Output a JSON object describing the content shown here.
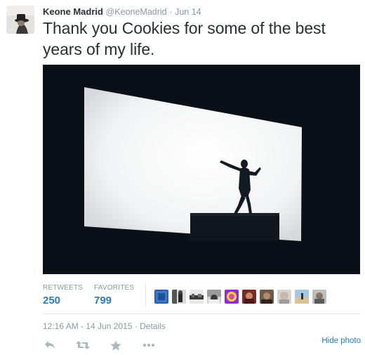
{
  "tweet": {
    "fullname": "Keone Madrid",
    "username": "@KeoneMadrid",
    "separator": "·",
    "time": "Jun 14",
    "text": "Thank you Cookies for some of the best years of my life."
  },
  "stats": {
    "retweets_label": "RETWEETS",
    "retweets_value": "250",
    "favorites_label": "FAVORITES",
    "favorites_value": "799",
    "favoriters_count": 10
  },
  "meta": {
    "timestamp": "12:16 AM - 14 Jun 2015",
    "dot": "·",
    "details": "Details"
  },
  "actions": {
    "icons": [
      "reply-icon",
      "retweet-icon",
      "favorite-icon",
      "more-icon"
    ],
    "hide_photo": "Hide photo"
  },
  "colors": {
    "link": "#2b7bb9",
    "muted": "#8899a6",
    "text": "#292f33"
  }
}
